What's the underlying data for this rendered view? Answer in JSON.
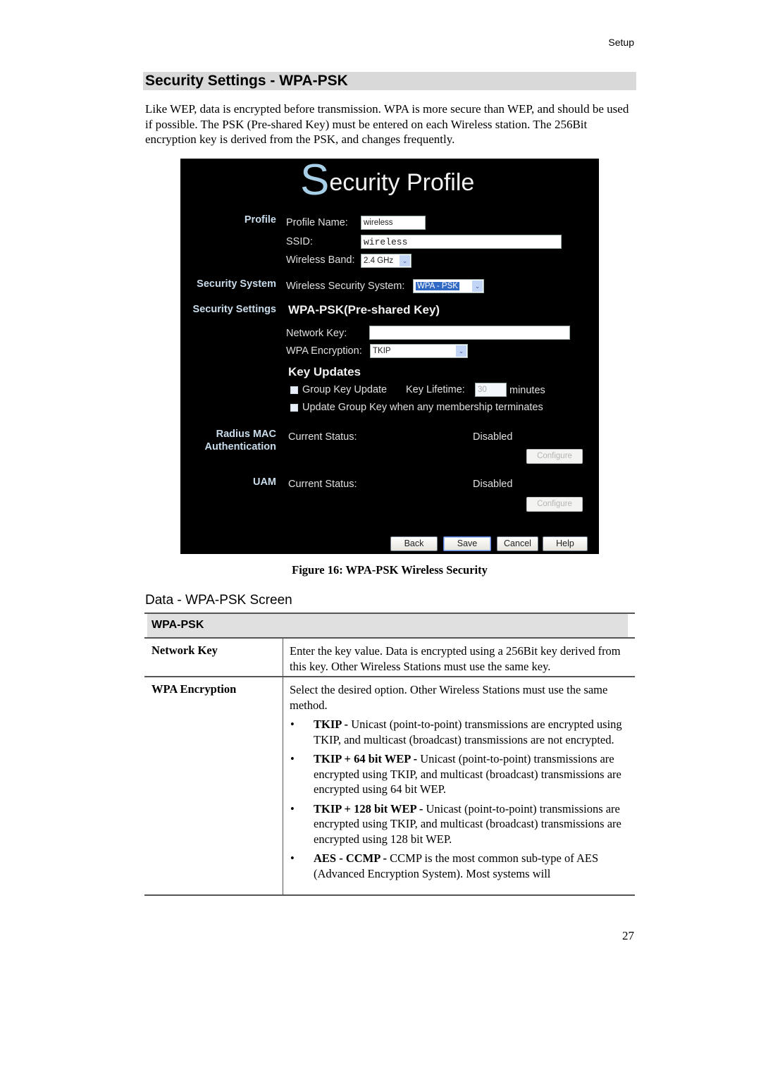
{
  "running_header": "Setup",
  "section_title": "Security Settings - WPA-PSK",
  "intro": "Like WEP, data is encrypted before transmission. WPA is more secure than WEP, and should be used if possible. The PSK (Pre-shared Key) must be entered on each Wireless station. The 256Bit encryption key is derived from the PSK, and changes frequently.",
  "screenshot": {
    "title_initial": "S",
    "title_rest": "ecurity Profile",
    "colors": {
      "background": "#000000",
      "title_initial": "#a8cfe8",
      "category": "#c9dceb",
      "selected": "#316ac5"
    },
    "categories": {
      "profile": "Profile",
      "security_system": "Security System",
      "security_settings": "Security Settings",
      "radius_line1": "Radius MAC",
      "radius_line2": "Authentication",
      "uam": "UAM"
    },
    "profile_name_label": "Profile Name:",
    "profile_name_value": "wireless",
    "ssid_label": "SSID:",
    "ssid_value": "wireless",
    "band_label": "Wireless Band:",
    "band_value": "2.4 GHz",
    "security_system_label": "Wireless Security System:",
    "security_system_value": "WPA - PSK",
    "psk_heading": "WPA-PSK(Pre-shared Key)",
    "network_key_label": "Network Key:",
    "network_key_value": "",
    "wpa_encryption_label": "WPA Encryption:",
    "wpa_encryption_value": "TKIP",
    "key_updates_heading": "Key Updates",
    "group_key_update_label": "Group Key Update",
    "group_key_update_checked": false,
    "key_lifetime_label": "Key Lifetime:",
    "key_lifetime_value": "30",
    "key_lifetime_unit": "minutes",
    "update_group_key_label": "Update Group Key when any membership terminates",
    "update_group_key_checked": false,
    "radius_status_label": "Current Status:",
    "radius_status_value": "Disabled",
    "radius_configure": "Configure",
    "uam_status_label": "Current Status:",
    "uam_status_value": "Disabled",
    "uam_configure": "Configure",
    "buttons": {
      "back": "Back",
      "save": "Save",
      "cancel": "Cancel",
      "help": "Help"
    },
    "arrow_glyph": "⌄"
  },
  "figure_caption": "Figure 16: WPA-PSK Wireless Security",
  "data_heading": "Data - WPA-PSK Screen",
  "table": {
    "header": "WPA-PSK",
    "rows": [
      {
        "key": "Network Key",
        "text": "Enter the key value. Data is encrypted using a 256Bit key derived from this key. Other Wireless Stations must use the same key."
      },
      {
        "key": "WPA Encryption",
        "text": "Select the desired option. Other Wireless Stations must use the same method.",
        "bullets": [
          {
            "term": "TKIP -",
            "desc": " Unicast (point-to-point) transmissions are encrypted using TKIP, and multicast (broadcast) transmissions are not encrypted."
          },
          {
            "term": "TKIP + 64 bit WEP -",
            "desc": " Unicast (point-to-point) transmissions are encrypted using TKIP, and multicast (broadcast) transmissions are encrypted using 64 bit WEP."
          },
          {
            "term": "TKIP + 128 bit WEP -",
            "desc": " Unicast (point-to-point) transmissions are encrypted using TKIP, and multicast (broadcast) transmissions are encrypted using 128 bit WEP."
          },
          {
            "term": "AES - CCMP -",
            "desc": " CCMP is the most common sub-type of AES (Advanced Encryption System). Most systems will"
          }
        ]
      }
    ]
  },
  "bullet_glyph": "•",
  "page_number": "27"
}
